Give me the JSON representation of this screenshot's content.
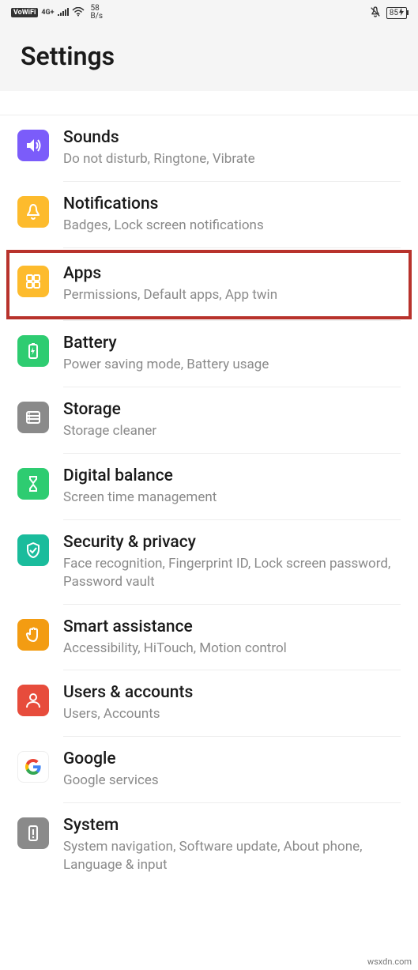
{
  "status_bar": {
    "vowifi": "VoWiFi",
    "signal_gen": "4G+",
    "net_speed_value": "58",
    "net_speed_unit": "B/s",
    "battery": "85"
  },
  "header": {
    "title": "Settings"
  },
  "items": [
    {
      "id": "sounds",
      "title": "Sounds",
      "subtitle": "Do not disturb, Ringtone, Vibrate",
      "color": "#7b5cfa",
      "icon": "sound-icon"
    },
    {
      "id": "notifications",
      "title": "Notifications",
      "subtitle": "Badges, Lock screen notifications",
      "color": "#fdbb2d",
      "icon": "bell-icon"
    },
    {
      "id": "apps",
      "title": "Apps",
      "subtitle": "Permissions, Default apps, App twin",
      "color": "#fdbb2d",
      "icon": "apps-icon",
      "highlighted": true
    },
    {
      "id": "battery",
      "title": "Battery",
      "subtitle": "Power saving mode, Battery usage",
      "color": "#2ecc71",
      "icon": "battery-icon"
    },
    {
      "id": "storage",
      "title": "Storage",
      "subtitle": "Storage cleaner",
      "color": "#8a8a8a",
      "icon": "storage-icon"
    },
    {
      "id": "digital-balance",
      "title": "Digital balance",
      "subtitle": "Screen time management",
      "color": "#2ecc71",
      "icon": "hourglass-icon"
    },
    {
      "id": "security",
      "title": "Security & privacy",
      "subtitle": "Face recognition, Fingerprint ID, Lock screen password, Password vault",
      "color": "#1abc9c",
      "icon": "shield-icon"
    },
    {
      "id": "smart-assistance",
      "title": "Smart assistance",
      "subtitle": "Accessibility, HiTouch, Motion control",
      "color": "#f39c12",
      "icon": "hand-icon"
    },
    {
      "id": "users-accounts",
      "title": "Users & accounts",
      "subtitle": "Users, Accounts",
      "color": "#e74c3c",
      "icon": "user-icon"
    },
    {
      "id": "google",
      "title": "Google",
      "subtitle": "Google services",
      "color": "#ffffff",
      "icon": "google-icon"
    },
    {
      "id": "system",
      "title": "System",
      "subtitle": "System navigation, Software update, About phone, Language & input",
      "color": "#8a8a8a",
      "icon": "system-icon"
    }
  ],
  "watermark": "wsxdn.com"
}
